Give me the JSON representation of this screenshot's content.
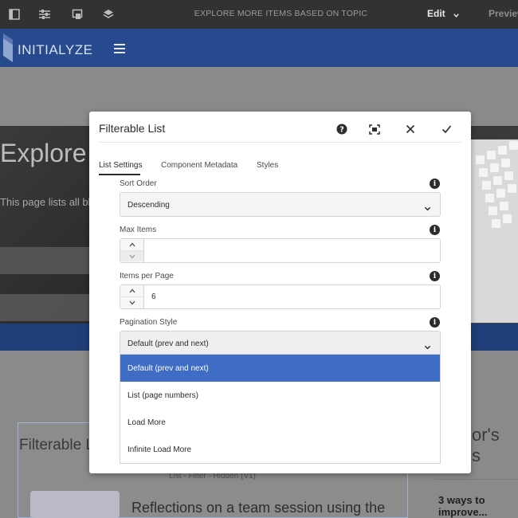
{
  "topbar": {
    "title": "EXPLORE MORE ITEMS BASED ON TOPIC",
    "mode": "Edit",
    "preview": "Preview"
  },
  "site": {
    "logo": "INITIALYZE"
  },
  "background": {
    "hero_title": "Explore m",
    "hero_sub": "This page lists all bl",
    "card_title": "Filterable L",
    "card_label": "List - Filter - Hidden (V1)",
    "card_item": "Reflections on a team session using the",
    "side_title_1": "or's",
    "side_title_2": "s",
    "side_item": "3 ways to improve..."
  },
  "dialog": {
    "title": "Filterable List",
    "tabs": [
      {
        "label": "List Settings",
        "active": true
      },
      {
        "label": "Component Metadata",
        "active": false
      },
      {
        "label": "Styles",
        "active": false
      }
    ],
    "fields": {
      "sort_order": {
        "label": "Sort Order",
        "value": "Descending"
      },
      "max_items": {
        "label": "Max Items",
        "value": ""
      },
      "items_per_page": {
        "label": "Items per Page",
        "value": "6"
      },
      "pagination_style": {
        "label": "Pagination Style",
        "value": "Default (prev and next)"
      }
    },
    "options": [
      "Default (prev and next)",
      "List (page numbers)",
      "Load More",
      "Infinite Load More"
    ],
    "selected_option": "Default (prev and next)"
  },
  "colors": {
    "accent": "#3f6cc4",
    "header_blue": "#274a8e",
    "editor_bar": "#323232"
  }
}
